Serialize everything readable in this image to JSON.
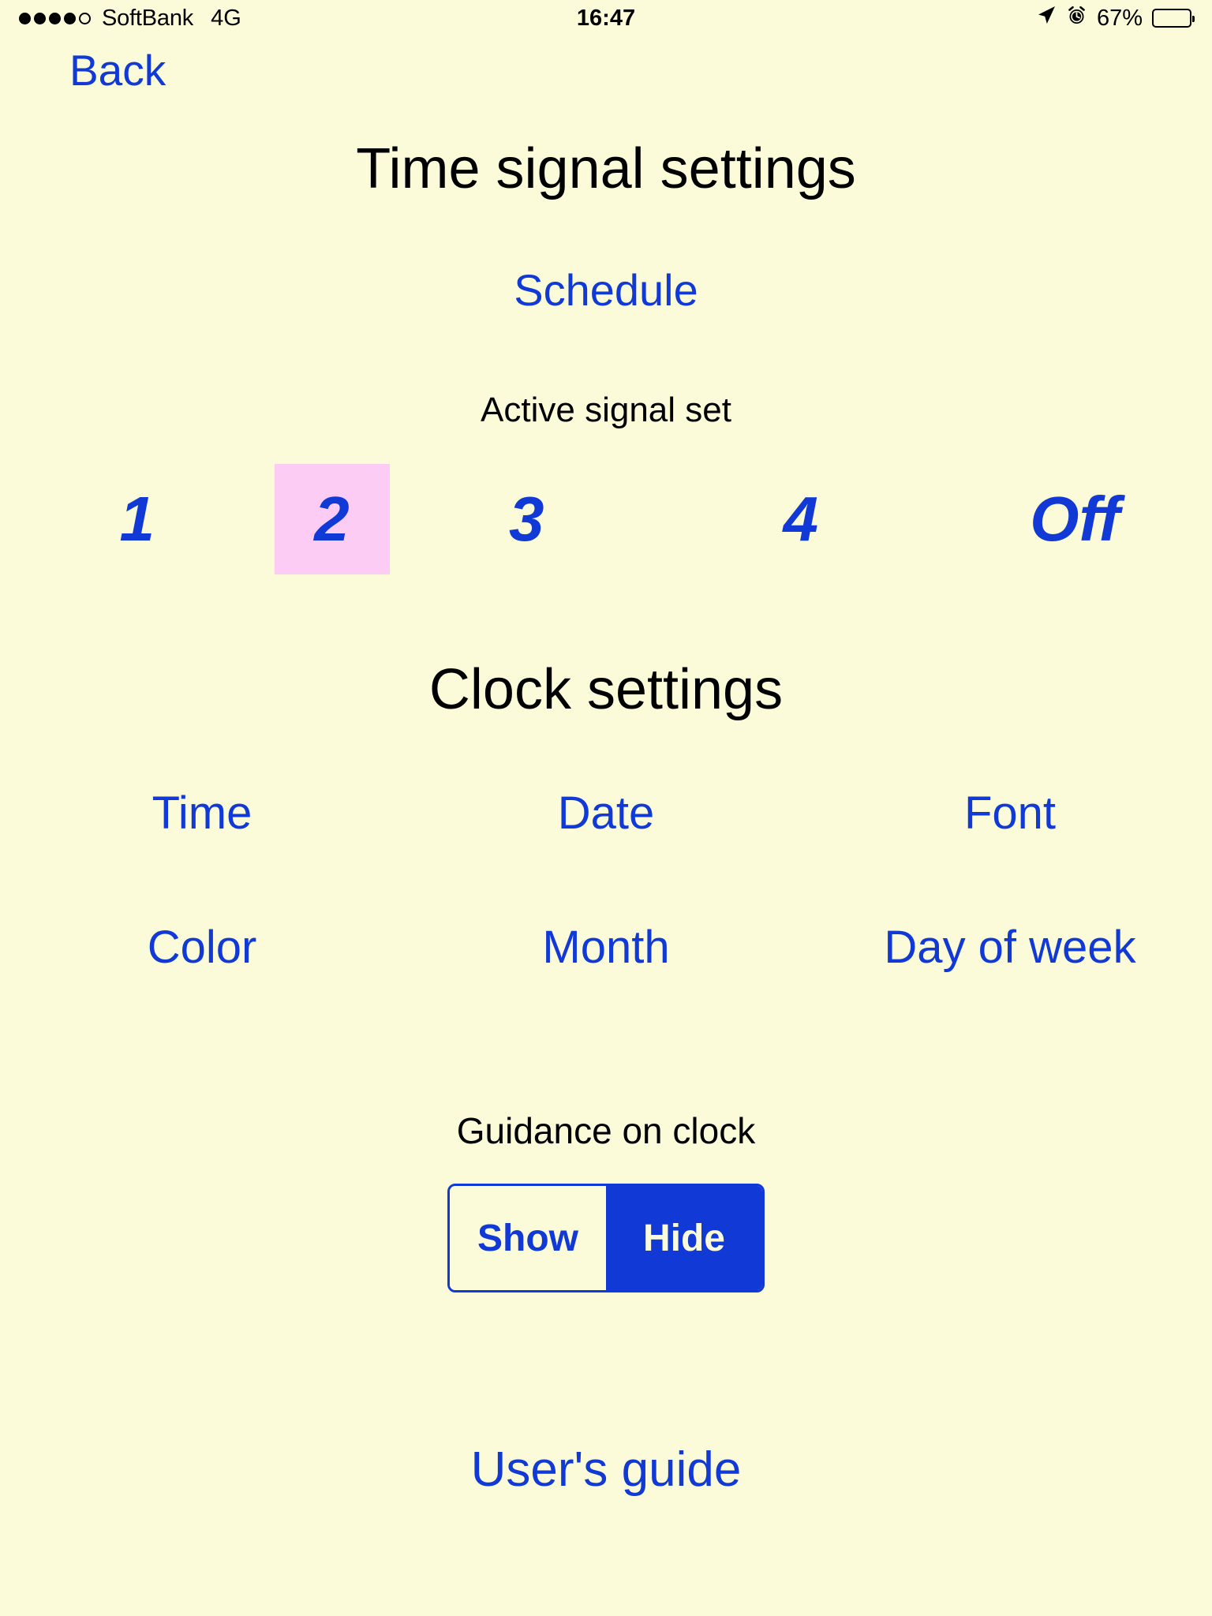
{
  "status_bar": {
    "signal_dots_filled": 4,
    "signal_dots_total": 5,
    "carrier": "SoftBank",
    "network": "4G",
    "time": "16:47",
    "battery_percent": "67%",
    "battery_level": 67,
    "icons": [
      "location-arrow-icon",
      "alarm-clock-icon",
      "battery-icon"
    ]
  },
  "nav": {
    "back_label": "Back"
  },
  "header": {
    "title": "Time signal settings"
  },
  "schedule": {
    "label": "Schedule"
  },
  "active_signal_set": {
    "label": "Active signal set",
    "options": [
      {
        "label": "1",
        "selected": false
      },
      {
        "label": "2",
        "selected": true
      },
      {
        "label": "3",
        "selected": false
      },
      {
        "label": "4",
        "selected": false
      },
      {
        "label": "Off",
        "selected": false
      }
    ],
    "selected_value": "2",
    "highlight_color": "#FDCCF5"
  },
  "clock_settings": {
    "title": "Clock settings",
    "rows": [
      [
        "Time",
        "Date",
        "Font"
      ],
      [
        "Color",
        "Month",
        "Day of week"
      ]
    ]
  },
  "guidance": {
    "label": "Guidance on clock",
    "options": [
      {
        "label": "Show",
        "selected": false
      },
      {
        "label": "Hide",
        "selected": true
      }
    ],
    "selected_value": "Hide"
  },
  "footer": {
    "user_guide_label": "User's guide"
  },
  "colors": {
    "background": "#FCFBD9",
    "link": "#1039D6",
    "text": "#000000",
    "highlight_pink": "#FDCCF5",
    "accent_blue": "#1039D6"
  }
}
